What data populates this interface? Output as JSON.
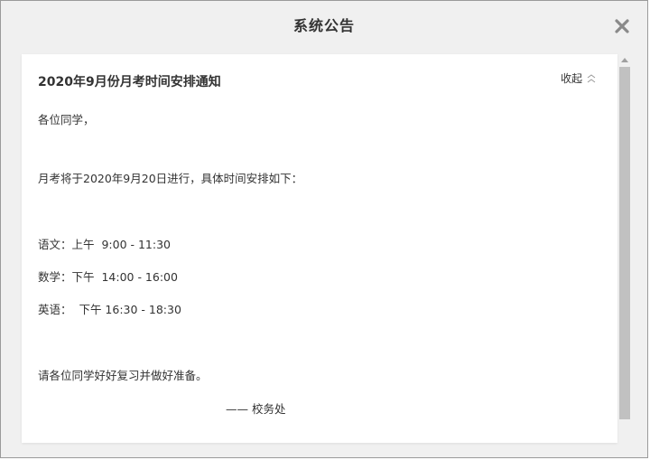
{
  "dialog": {
    "title": "系统公告",
    "close_icon": "close-x-icon"
  },
  "notice": {
    "title": "2020年9月份月考时间安排通知",
    "collapse_label": "收起",
    "collapse_icon": "chevron-up-icon",
    "greeting": "各位同学，",
    "intro": "月考将于2020年9月20日进行，具体时间安排如下：",
    "schedule": [
      "语文：上午  9:00 - 11:30",
      "数学：下午  14:00 - 16:00",
      "英语：  下午 16:30 - 18:30"
    ],
    "closing": "请各位同学好好复习并做好准备。",
    "signature": "—— 校务处"
  }
}
